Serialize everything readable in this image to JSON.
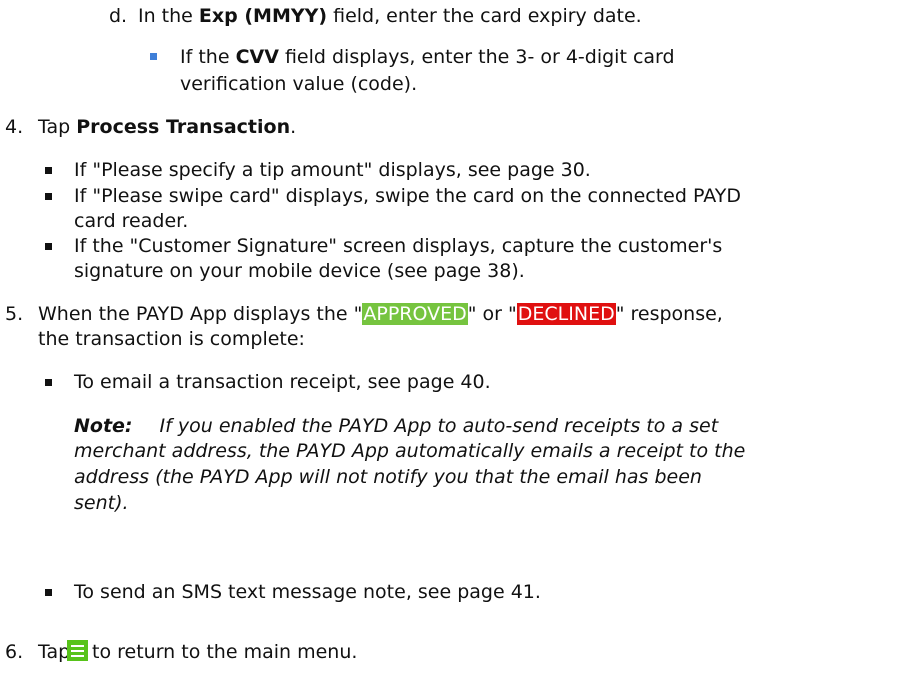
{
  "steps": {
    "d": {
      "marker": "d.",
      "pre": "In the ",
      "bold": "Exp (MMYY)",
      "post": " field, enter the card expiry date.",
      "sub": {
        "pre": "If the ",
        "bold": "CVV",
        "post_1": " field displays, enter the 3- or 4-digit card",
        "post_2": "verification value (code)."
      }
    },
    "s4": {
      "marker": "4.",
      "pre": "Tap ",
      "bold": "Process Transaction",
      "post": ".",
      "bullets": [
        "If \"Please specify a tip amount\" displays, see page 30.",
        "If \"Please swipe card\" displays, swipe the card on the connected PAYD",
        "card reader.",
        "If the \"Customer Signature\" screen displays, capture the customer's",
        "signature on your mobile device (see page 38)."
      ]
    },
    "s5": {
      "marker": "5.",
      "pre": "When the PAYD App displays the \"",
      "approved": "APPROVED",
      "mid": "\" or \"",
      "declined": "DECLINED",
      "post": "\" response,",
      "line2": "the transaction is complete:",
      "bullet_1": "To email a transaction receipt, see page 40.",
      "note_label": "Note:",
      "note_lines": [
        "If you enabled the PAYD App to auto-send receipts to a set",
        "merchant address, the PAYD App automatically emails a receipt to the",
        "address (the PAYD App will not notify you that the email has been",
        "sent)."
      ],
      "bullet_2": "To send an SMS text message note, see page 41."
    },
    "s6": {
      "marker": "6.",
      "pre": "Tap",
      "icon": "menu-icon",
      "post": "to return to the main menu."
    }
  },
  "colors": {
    "approved_bg": "#76c43f",
    "declined_bg": "#e01010",
    "menu_icon_bg": "#57c31a",
    "sub_bullet": "#3f7fd8"
  }
}
